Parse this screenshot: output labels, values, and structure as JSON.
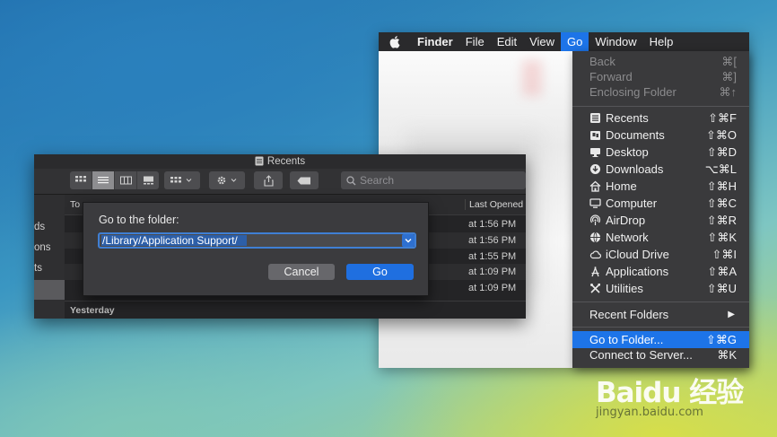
{
  "menubar": {
    "items": [
      {
        "label": "Finder",
        "bold": true
      },
      {
        "label": "File"
      },
      {
        "label": "Edit"
      },
      {
        "label": "View"
      },
      {
        "label": "Go",
        "active": true
      },
      {
        "label": "Window"
      },
      {
        "label": "Help"
      }
    ]
  },
  "go_menu": {
    "nav": [
      {
        "label": "Back",
        "shortcut": "⌘[",
        "enabled": false
      },
      {
        "label": "Forward",
        "shortcut": "⌘]",
        "enabled": false
      },
      {
        "label": "Enclosing Folder",
        "shortcut": "⌘↑",
        "enabled": false
      }
    ],
    "places": [
      {
        "label": "Recents",
        "shortcut": "⇧⌘F",
        "icon": "recents-icon"
      },
      {
        "label": "Documents",
        "shortcut": "⇧⌘O",
        "icon": "documents-icon"
      },
      {
        "label": "Desktop",
        "shortcut": "⇧⌘D",
        "icon": "desktop-icon"
      },
      {
        "label": "Downloads",
        "shortcut": "⌥⌘L",
        "icon": "downloads-icon"
      },
      {
        "label": "Home",
        "shortcut": "⇧⌘H",
        "icon": "home-icon"
      },
      {
        "label": "Computer",
        "shortcut": "⇧⌘C",
        "icon": "computer-icon"
      },
      {
        "label": "AirDrop",
        "shortcut": "⇧⌘R",
        "icon": "airdrop-icon"
      },
      {
        "label": "Network",
        "shortcut": "⇧⌘K",
        "icon": "network-icon"
      },
      {
        "label": "iCloud Drive",
        "shortcut": "⇧⌘I",
        "icon": "icloud-icon"
      },
      {
        "label": "Applications",
        "shortcut": "⇧⌘A",
        "icon": "applications-icon"
      },
      {
        "label": "Utilities",
        "shortcut": "⇧⌘U",
        "icon": "utilities-icon"
      }
    ],
    "recent_folders": {
      "label": "Recent Folders",
      "submenu_arrow": "▶"
    },
    "actions": [
      {
        "label": "Go to Folder...",
        "shortcut": "⇧⌘G",
        "selected": true
      },
      {
        "label": "Connect to Server...",
        "shortcut": "⌘K",
        "selected": false
      }
    ]
  },
  "dark_window": {
    "title": "Recents",
    "search_placeholder": "Search",
    "sidebar_fragments": [
      "ds",
      "ons",
      "ts"
    ],
    "columns": {
      "name": "To",
      "last_opened": "Last Opened"
    },
    "rows": [
      {
        "time": "at 1:56 PM"
      },
      {
        "time": "at 1:56 PM"
      },
      {
        "time": "at 1:55 PM"
      },
      {
        "time": "at 1:09 PM"
      },
      {
        "time": "at 1:09 PM"
      }
    ],
    "group_yesterday": "Yesterday"
  },
  "goto_sheet": {
    "prompt": "Go to the folder:",
    "path_value": "/Library/Application Support/",
    "cancel_label": "Cancel",
    "go_label": "Go"
  },
  "watermark": {
    "main": "Baidu 经验",
    "sub": "jingyan.baidu.com"
  },
  "colors": {
    "accent": "#1d74e8",
    "menu_bg": "#3a3a3c",
    "dark_window_bg": "#2b2b2d"
  }
}
